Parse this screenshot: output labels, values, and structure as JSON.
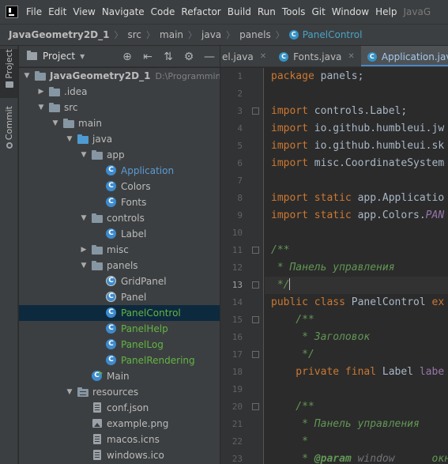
{
  "menubar": {
    "items": [
      "File",
      "Edit",
      "View",
      "Navigate",
      "Code",
      "Refactor",
      "Build",
      "Run",
      "Tools",
      "Git",
      "Window",
      "Help"
    ],
    "overflow_title": "JavaG"
  },
  "breadcrumb": {
    "project": "JavaGeometry2D_1",
    "parts": [
      "src",
      "main",
      "java",
      "panels"
    ],
    "current": "PanelControl"
  },
  "toolstrip": {
    "project_tab": "Project",
    "commit_tab": "Commit"
  },
  "project_panel": {
    "title": "Project",
    "tools": [
      "target-icon",
      "collapse-icon",
      "expand-icon",
      "gear-icon",
      "minimize-icon"
    ]
  },
  "tree": [
    {
      "label": "JavaGeometry2D_1",
      "path": "D:\\Programming\\J",
      "icon": "folder",
      "state": "open",
      "color": "bold"
    },
    {
      "label": ".idea",
      "icon": "folder",
      "state": "closed"
    },
    {
      "label": "src",
      "icon": "folder",
      "state": "open"
    },
    {
      "label": "main",
      "icon": "folder",
      "state": "open"
    },
    {
      "label": "java",
      "icon": "folder-blue",
      "state": "open"
    },
    {
      "label": "app",
      "icon": "folder",
      "state": "open"
    },
    {
      "label": "Application",
      "icon": "class",
      "color": "vblue"
    },
    {
      "label": "Colors",
      "icon": "class"
    },
    {
      "label": "Fonts",
      "icon": "class"
    },
    {
      "label": "controls",
      "icon": "folder",
      "state": "open"
    },
    {
      "label": "Label",
      "icon": "class"
    },
    {
      "label": "misc",
      "icon": "folder",
      "state": "closed"
    },
    {
      "label": "panels",
      "icon": "folder",
      "state": "open"
    },
    {
      "label": "GridPanel",
      "icon": "class-abs"
    },
    {
      "label": "Panel",
      "icon": "class-abs"
    },
    {
      "label": "PanelControl",
      "icon": "class",
      "color": "green",
      "selected": true
    },
    {
      "label": "PanelHelp",
      "icon": "class",
      "color": "green"
    },
    {
      "label": "PanelLog",
      "icon": "class",
      "color": "green"
    },
    {
      "label": "PanelRendering",
      "icon": "class",
      "color": "green"
    },
    {
      "label": "Main",
      "icon": "main-class"
    },
    {
      "label": "resources",
      "icon": "folder-res",
      "state": "open"
    },
    {
      "label": "conf.json",
      "icon": "file"
    },
    {
      "label": "example.png",
      "icon": "image"
    },
    {
      "label": "macos.icns",
      "icon": "file"
    },
    {
      "label": "windows.ico",
      "icon": "file"
    }
  ],
  "editor_tabs": [
    {
      "label": "el.java",
      "active": false
    },
    {
      "label": "Fonts.java",
      "active": false
    },
    {
      "label": "Application.java",
      "active": true
    }
  ],
  "current_line": 13,
  "line_numbers": [
    "1",
    "2",
    "3",
    "4",
    "5",
    "6",
    "7",
    "8",
    "9",
    "10",
    "11",
    "12",
    "13",
    "14",
    "15",
    "16",
    "17",
    "18",
    "19",
    "20",
    "21",
    "22",
    "23"
  ],
  "code": {
    "l1_kw": "package",
    "l1_rest": " panels;",
    "l3_kw": "import",
    "l3_rest": " controls.Label;",
    "l4_kw": "import",
    "l4_rest": " io.github.humbleui.jw",
    "l5_kw": "import",
    "l5_rest": " io.github.humbleui.sk",
    "l6_kw": "import",
    "l6_rest": " misc.CoordinateSystem",
    "l8_kw": "import static",
    "l8_rest": " app.Applicatio",
    "l9_kw": "import static",
    "l9_rest": " app.Colors.",
    "l9_const": "PAN",
    "l11": "/**",
    "l12": " * Панель управления",
    "l13": " */",
    "l14_kw": "public class",
    "l14_rest": " PanelControl ",
    "l14_kw2": "ex",
    "l15": "    /**",
    "l16": "     * Заголовок",
    "l17": "     */",
    "l18_kw": "    private final",
    "l18_rest": " Label ",
    "l18_name": "labe",
    "l20": "    /**",
    "l21": "     * Панель управления",
    "l22": "     *",
    "l23_pre": "     * ",
    "l23_tag": "@param",
    "l23_p": " window",
    "l23_post": "      окн"
  }
}
